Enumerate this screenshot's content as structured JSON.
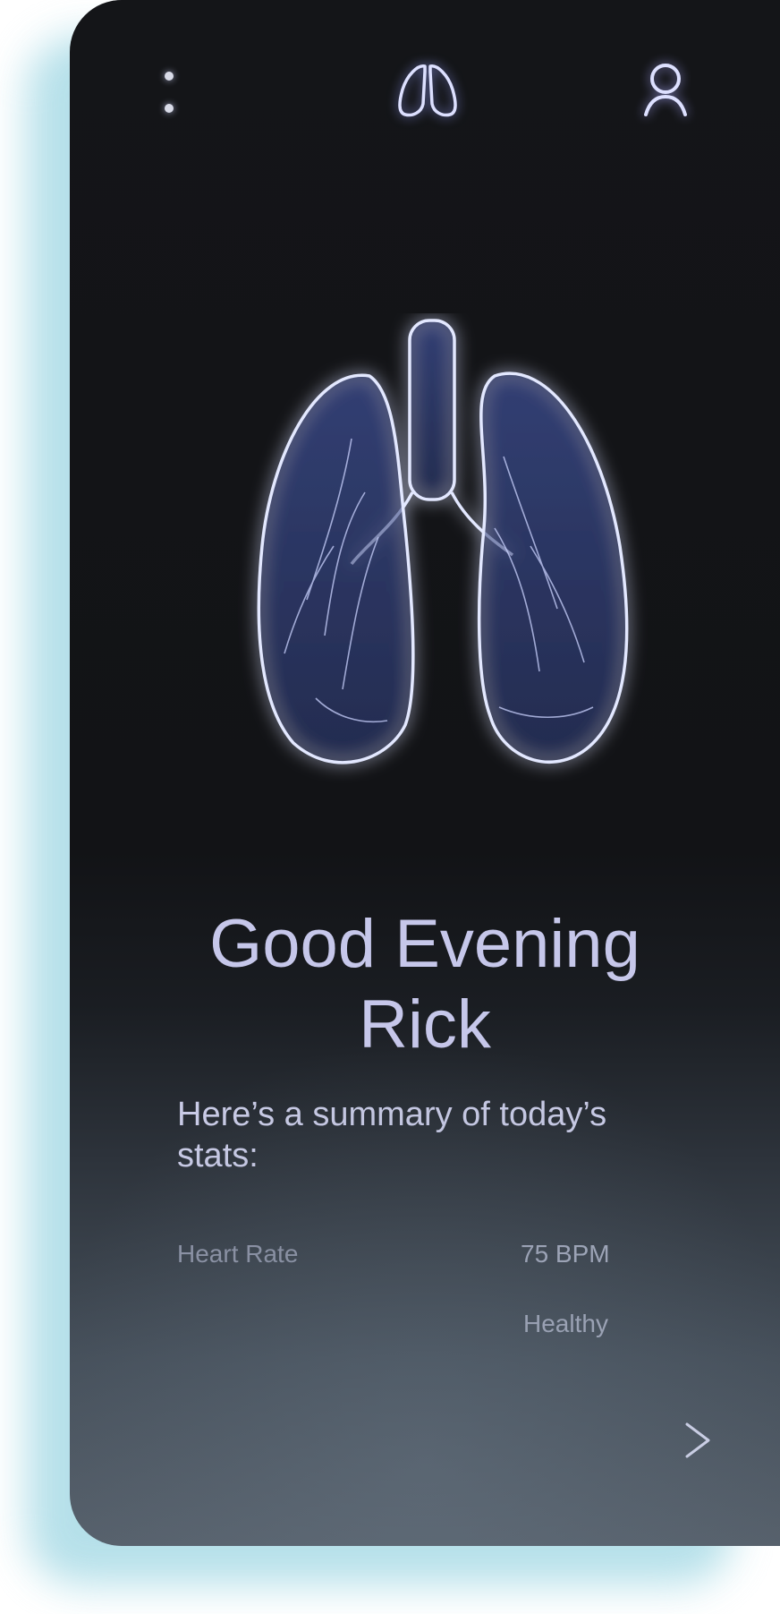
{
  "header": {
    "menu_icon": "vertical-dots-icon",
    "logo_icon": "lungs-logo-icon",
    "profile_icon": "user-icon"
  },
  "hero": {
    "image": "3d-lungs-illustration"
  },
  "greeting": {
    "line1": "Good Evening",
    "line2": "Rick"
  },
  "summary": {
    "text": "Here’s a summary of today’s stats:"
  },
  "stats": {
    "label": "Heart Rate",
    "value": "75 BPM",
    "status": "Healthy"
  },
  "footer": {
    "next_icon": "chevron-right-icon"
  },
  "colors": {
    "accent": "#c6c7ea",
    "glow": "#8fa0ff",
    "background_top": "#141518",
    "background_bottom": "#56606b",
    "shadow": "#a9dbe6"
  }
}
